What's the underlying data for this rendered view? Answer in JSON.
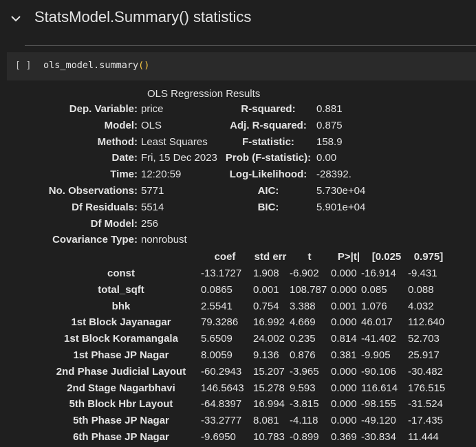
{
  "section": {
    "title": "StatsModel.Summary() statistics"
  },
  "cell": {
    "run_indicator": "[ ]",
    "code": "ols_model.summary",
    "code_parens": "()"
  },
  "summary": {
    "title": "OLS Regression Results",
    "left_stats": [
      {
        "label": "Dep. Variable:",
        "value": "price"
      },
      {
        "label": "Model:",
        "value": "OLS"
      },
      {
        "label": "Method:",
        "value": "Least Squares"
      },
      {
        "label": "Date:",
        "value": "Fri, 15 Dec 2023"
      },
      {
        "label": "Time:",
        "value": "12:20:59"
      },
      {
        "label": "No. Observations:",
        "value": "5771"
      },
      {
        "label": "Df Residuals:",
        "value": "5514"
      },
      {
        "label": "Df Model:",
        "value": "256"
      },
      {
        "label": "Covariance Type:",
        "value": "nonrobust"
      }
    ],
    "right_stats": [
      {
        "label": "R-squared:",
        "value": "0.881"
      },
      {
        "label": "Adj. R-squared:",
        "value": "0.875"
      },
      {
        "label": "F-statistic:",
        "value": "158.9"
      },
      {
        "label": "Prob (F-statistic):",
        "value": "0.00"
      },
      {
        "label": "Log-Likelihood:",
        "value": "-28392."
      },
      {
        "label": "AIC:",
        "value": "5.730e+04"
      },
      {
        "label": "BIC:",
        "value": "5.901e+04"
      }
    ],
    "coef_headers": [
      "coef",
      "std err",
      "t",
      "P>|t|",
      "[0.025",
      "0.975]"
    ],
    "coef_rows": [
      {
        "name": "const",
        "coef": "-13.1727",
        "std_err": "1.908",
        "t": "-6.902",
        "p": "0.000",
        "lo": "-16.914",
        "hi": "-9.431"
      },
      {
        "name": "total_sqft",
        "coef": "0.0865",
        "std_err": "0.001",
        "t": "108.787",
        "p": "0.000",
        "lo": "0.085",
        "hi": "0.088"
      },
      {
        "name": "bhk",
        "coef": "2.5541",
        "std_err": "0.754",
        "t": "3.388",
        "p": "0.001",
        "lo": "1.076",
        "hi": "4.032"
      },
      {
        "name": "1st Block Jayanagar",
        "coef": "79.3286",
        "std_err": "16.992",
        "t": "4.669",
        "p": "0.000",
        "lo": "46.017",
        "hi": "112.640"
      },
      {
        "name": "1st Block Koramangala",
        "coef": "5.6509",
        "std_err": "24.002",
        "t": "0.235",
        "p": "0.814",
        "lo": "-41.402",
        "hi": "52.703"
      },
      {
        "name": "1st Phase JP Nagar",
        "coef": "8.0059",
        "std_err": "9.136",
        "t": "0.876",
        "p": "0.381",
        "lo": "-9.905",
        "hi": "25.917"
      },
      {
        "name": "2nd Phase Judicial Layout",
        "coef": "-60.2943",
        "std_err": "15.207",
        "t": "-3.965",
        "p": "0.000",
        "lo": "-90.106",
        "hi": "-30.482"
      },
      {
        "name": "2nd Stage Nagarbhavi",
        "coef": "146.5643",
        "std_err": "15.278",
        "t": "9.593",
        "p": "0.000",
        "lo": "116.614",
        "hi": "176.515"
      },
      {
        "name": "5th Block Hbr Layout",
        "coef": "-64.8397",
        "std_err": "16.994",
        "t": "-3.815",
        "p": "0.000",
        "lo": "-98.155",
        "hi": "-31.524"
      },
      {
        "name": "5th Phase JP Nagar",
        "coef": "-33.2777",
        "std_err": "8.081",
        "t": "-4.118",
        "p": "0.000",
        "lo": "-49.120",
        "hi": "-17.435"
      },
      {
        "name": "6th Phase JP Nagar",
        "coef": "-9.6950",
        "std_err": "10.783",
        "t": "-0.899",
        "p": "0.369",
        "lo": "-30.834",
        "hi": "11.444"
      }
    ]
  }
}
